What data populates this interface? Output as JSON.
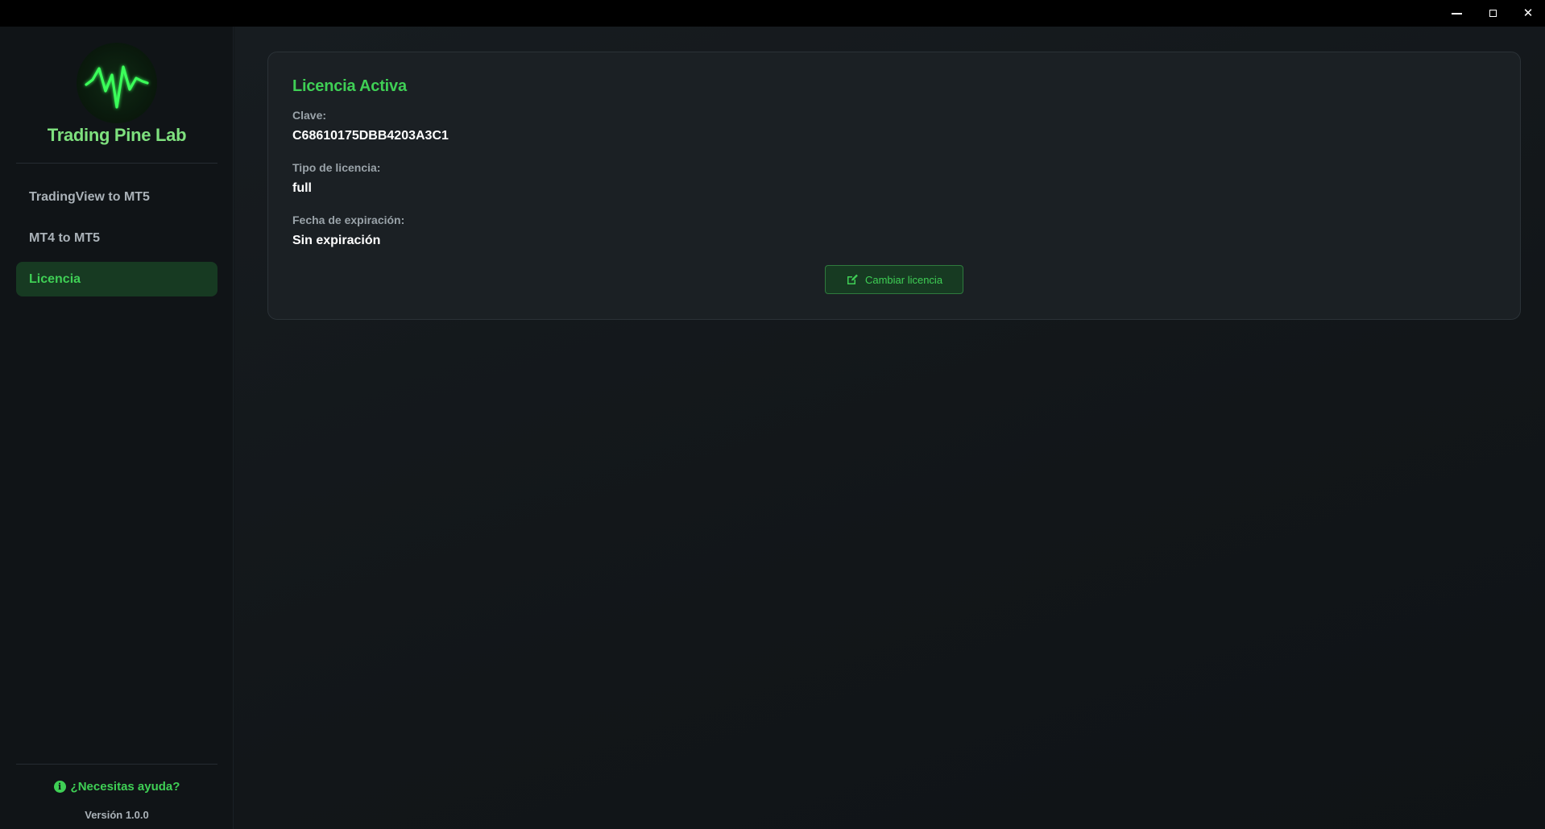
{
  "window": {
    "minimize_icon": "minimize-icon",
    "maximize_icon": "maximize-icon",
    "close_icon": "close-icon",
    "close_glyph": "✕"
  },
  "sidebar": {
    "brand": "Trading Pine Lab",
    "logo_icon": "waveform-logo-icon",
    "items": [
      {
        "label": "TradingView to MT5",
        "active": false
      },
      {
        "label": "MT4 to MT5",
        "active": false
      },
      {
        "label": "Licencia",
        "active": true
      }
    ],
    "help_label": "¿Necesitas ayuda?",
    "help_icon_glyph": "i",
    "version": "Versión 1.0.0"
  },
  "license": {
    "title": "Licencia Activa",
    "key_label": "Clave:",
    "key_value": "C68610175DBB4203A3C1",
    "type_label": "Tipo de licencia:",
    "type_value": "full",
    "expiry_label": "Fecha de expiración:",
    "expiry_value": "Sin expiración",
    "change_button": "Cambiar licencia",
    "change_icon": "edit-icon"
  },
  "colors": {
    "accent": "#3fcf55",
    "brand": "#7ee07e",
    "active_bg": "#173a22",
    "titlebar": "#000000"
  }
}
